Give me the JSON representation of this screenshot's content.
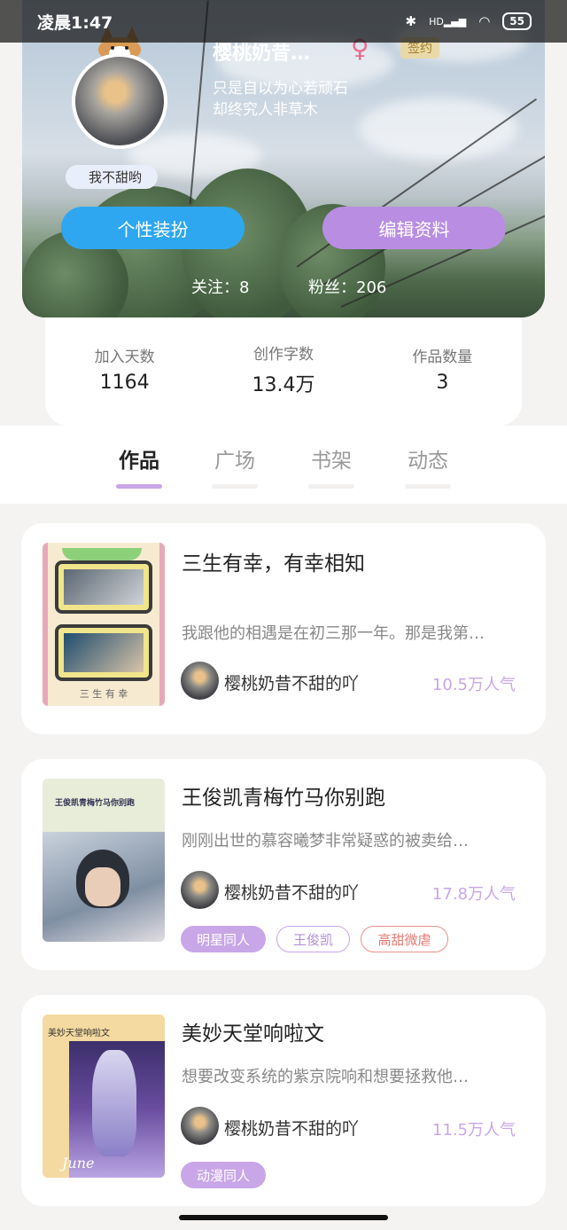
{
  "status": {
    "time": "凌晨1:47",
    "battery": "55",
    "net": "HD"
  },
  "profile": {
    "username": "樱桃奶昔…",
    "gender_symbol": "♀",
    "signed_badge": "签约",
    "bio_line1": "只是自以为心若顽石",
    "bio_line2": "却终究人非草木",
    "nickname_badge": "我不甜哟",
    "btn_dress": "个性装扮",
    "btn_edit": "编辑资料",
    "following": "关注：8",
    "followers": "粉丝：206"
  },
  "stats": [
    {
      "label": "加入天数",
      "value": "1164"
    },
    {
      "label": "创作字数",
      "value": "13.4万"
    },
    {
      "label": "作品数量",
      "value": "3"
    }
  ],
  "tabs": [
    "作品",
    "广场",
    "书架",
    "动态"
  ],
  "works": [
    {
      "title": "三生有幸，有幸相知",
      "desc": "我跟他的相遇是在初三那一年。那是我第…",
      "author": "樱桃奶昔不甜的吖",
      "popularity": "10.5万人气",
      "tags": [],
      "cover_text": "三 生 有 幸"
    },
    {
      "title": "王俊凯青梅竹马你别跑",
      "desc": "刚刚出世的慕容曦梦非常疑惑的被卖给…",
      "author": "樱桃奶昔不甜的吖",
      "popularity": "17.8万人气",
      "tags": [
        "明星同人",
        "王俊凯",
        "高甜微虐"
      ],
      "cover_text": "王俊凯青梅竹马你别跑"
    },
    {
      "title": "美妙天堂响啦文",
      "desc": "想要改变系统的紫京院响和想要拯救他…",
      "author": "樱桃奶昔不甜的吖",
      "popularity": "11.5万人气",
      "tags": [
        "动漫同人"
      ],
      "cover_text": "美妙天堂响啦文",
      "cover_sign": "June"
    }
  ]
}
